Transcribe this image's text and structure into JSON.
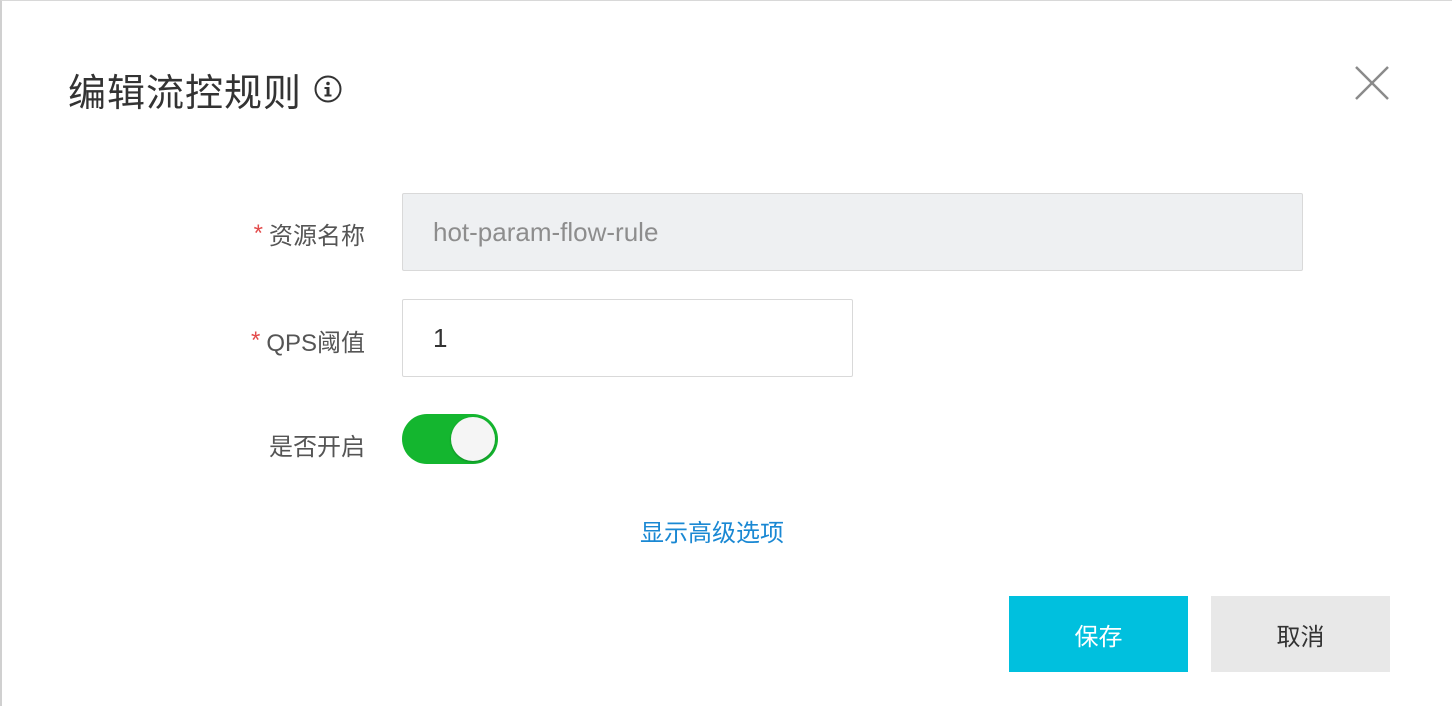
{
  "dialog": {
    "title": "编辑流控规则",
    "info_icon": "info-circle-icon",
    "close_icon": "close-icon"
  },
  "form": {
    "resource_name": {
      "label": "资源名称",
      "required": "*",
      "value": "hot-param-flow-rule"
    },
    "qps_threshold": {
      "label": "QPS阈值",
      "required": "*",
      "value": "1"
    },
    "enabled": {
      "label": "是否开启",
      "state": "on"
    },
    "advanced_link": "显示高级选项"
  },
  "actions": {
    "save_label": "保存",
    "cancel_label": "取消"
  },
  "colors": {
    "toggle_on": "#14b62f",
    "save_button": "#00c0de",
    "link": "#1a88d3",
    "required": "#e34b4b"
  }
}
